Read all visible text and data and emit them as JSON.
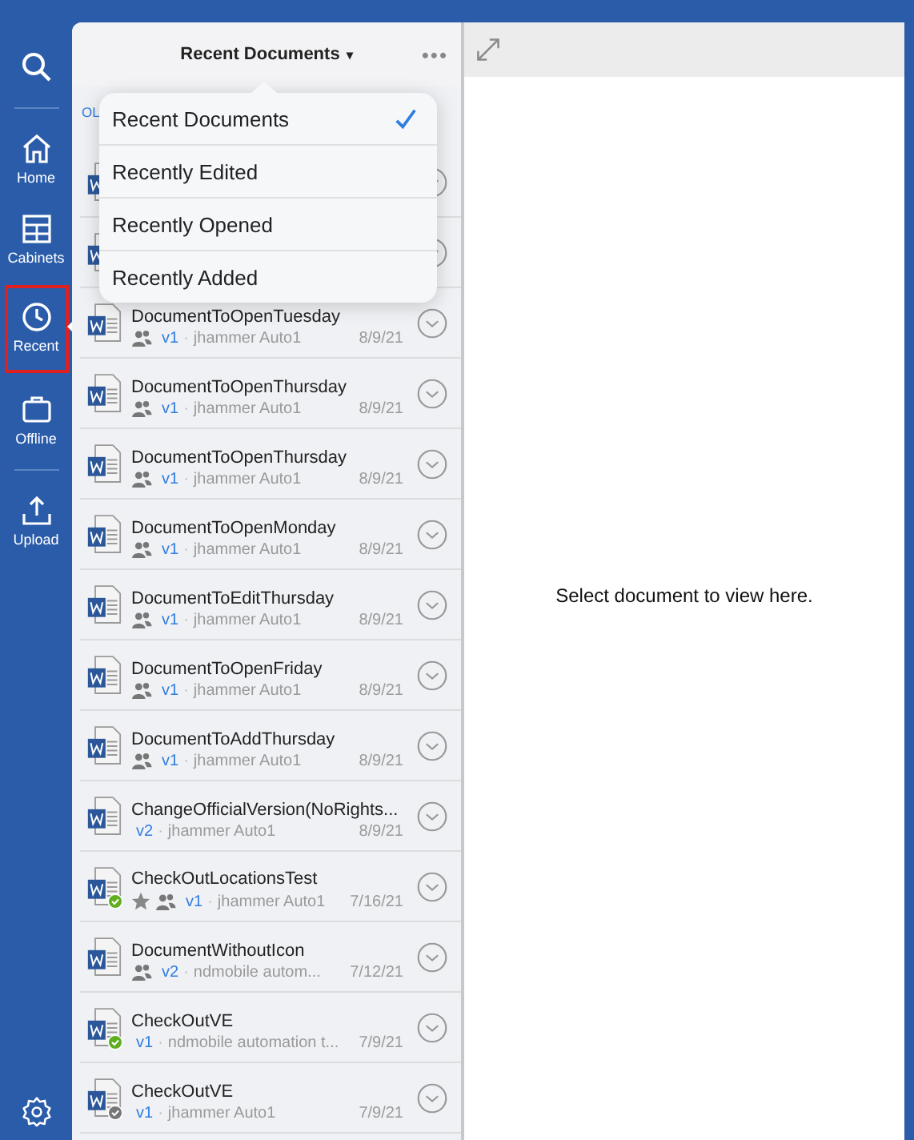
{
  "sidebar": {
    "items": [
      {
        "kind": "search",
        "selected": false
      },
      {
        "kind": "divider"
      },
      {
        "kind": "home",
        "label": "Home",
        "selected": false
      },
      {
        "kind": "cabinets",
        "label": "Cabinets",
        "selected": false
      },
      {
        "kind": "recent",
        "label": "Recent",
        "selected": true
      },
      {
        "kind": "offline",
        "label": "Offline",
        "selected": false
      },
      {
        "kind": "divider"
      },
      {
        "kind": "upload",
        "label": "Upload",
        "selected": false
      }
    ],
    "settings": true
  },
  "list": {
    "title": "Recent Documents",
    "title_caret": "▾",
    "more": "•••",
    "subheader": "OL",
    "rows": [
      {
        "kind": "covered"
      },
      {
        "kind": "covered"
      },
      {
        "kind": "doc",
        "name": "DocumentToOpenTuesday",
        "shared": true,
        "version": "v1",
        "separator": "·",
        "author": "jhammer Auto1",
        "date": "8/9/21"
      },
      {
        "kind": "doc",
        "name": "DocumentToOpenThursday",
        "shared": true,
        "version": "v1",
        "separator": "·",
        "author": "jhammer Auto1",
        "date": "8/9/21"
      },
      {
        "kind": "doc",
        "name": "DocumentToOpenThursday",
        "shared": true,
        "version": "v1",
        "separator": "·",
        "author": "jhammer Auto1",
        "date": "8/9/21"
      },
      {
        "kind": "doc",
        "name": "DocumentToOpenMonday",
        "shared": true,
        "version": "v1",
        "separator": "·",
        "author": "jhammer Auto1",
        "date": "8/9/21"
      },
      {
        "kind": "doc",
        "name": "DocumentToEditThursday",
        "shared": true,
        "version": "v1",
        "separator": "·",
        "author": "jhammer Auto1",
        "date": "8/9/21"
      },
      {
        "kind": "doc",
        "name": "DocumentToOpenFriday",
        "shared": true,
        "version": "v1",
        "separator": "·",
        "author": "jhammer Auto1",
        "date": "8/9/21"
      },
      {
        "kind": "doc",
        "name": "DocumentToAddThursday",
        "shared": true,
        "version": "v1",
        "separator": "·",
        "author": "jhammer Auto1",
        "date": "8/9/21"
      },
      {
        "kind": "doc",
        "name": "ChangeOfficialVersion(NoRights...",
        "shared": false,
        "version": "v2",
        "separator": "·",
        "author": "jhammer Auto1",
        "date": "8/9/21"
      },
      {
        "kind": "doc",
        "name": "CheckOutLocationsTest",
        "color": "#5fae1f",
        "starred": true,
        "shared": true,
        "version": "v1",
        "separator": "·",
        "author": "jhammer Auto1",
        "date": "7/16/21"
      },
      {
        "kind": "doc",
        "name": "DocumentWithoutIcon",
        "shared": true,
        "version": "v2",
        "separator": "·",
        "author": "ndmobile autom...",
        "date": "7/12/21"
      },
      {
        "kind": "doc",
        "name": "CheckOutVE",
        "color": "#5fae1f",
        "shared": false,
        "version": "v1",
        "separator": "·",
        "author": "ndmobile automation t...",
        "date": "7/9/21"
      },
      {
        "kind": "doc",
        "name": "CheckOutVE",
        "color": "#777777",
        "shared": false,
        "version": "v1",
        "separator": "·",
        "author": "jhammer Auto1",
        "date": "7/9/21"
      }
    ]
  },
  "menu": {
    "items": [
      {
        "label": "Recent Documents",
        "selected": true
      },
      {
        "label": "Recently Edited",
        "selected": false
      },
      {
        "label": "Recently Opened",
        "selected": false
      },
      {
        "label": "Recently Added",
        "selected": false
      }
    ]
  },
  "viewer": {
    "message": "Select document to view here."
  }
}
